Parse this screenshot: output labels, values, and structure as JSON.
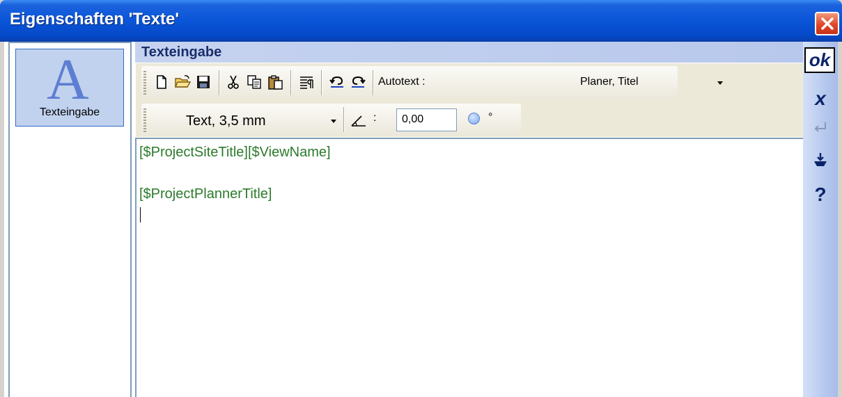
{
  "window": {
    "title": "Eigenschaften 'Texte'"
  },
  "left_panel": {
    "items": [
      {
        "label": "Texteingabe",
        "icon": "letter-a-icon",
        "glyph": "A"
      }
    ]
  },
  "header": {
    "title": "Texteingabe"
  },
  "toolbar1": {
    "buttons": [
      "new-icon",
      "open-icon",
      "save-icon",
      "cut-icon",
      "copy-icon",
      "paste-icon",
      "paragraph-icon",
      "undo-icon",
      "redo-icon"
    ],
    "autotext_label": "Autotext :",
    "autotext_value": "Planer, Titel"
  },
  "toolbar2": {
    "font_value": "Text, 3,5 mm",
    "angle_separator": ":",
    "angle_value": "0,00",
    "angle_unit": "°"
  },
  "editor": {
    "lines": [
      "[$ProjectSiteTitle][$ViewName]",
      "[$ProjectPlannerTitle]"
    ]
  },
  "right_bar": {
    "ok_label": "ok",
    "cancel_label": "x",
    "help_label": "?"
  },
  "colors": {
    "title_bar": "#0a55d8",
    "editor_text": "#2c7a2c",
    "header_text": "#1a2d6b",
    "close": "#e0472a"
  }
}
